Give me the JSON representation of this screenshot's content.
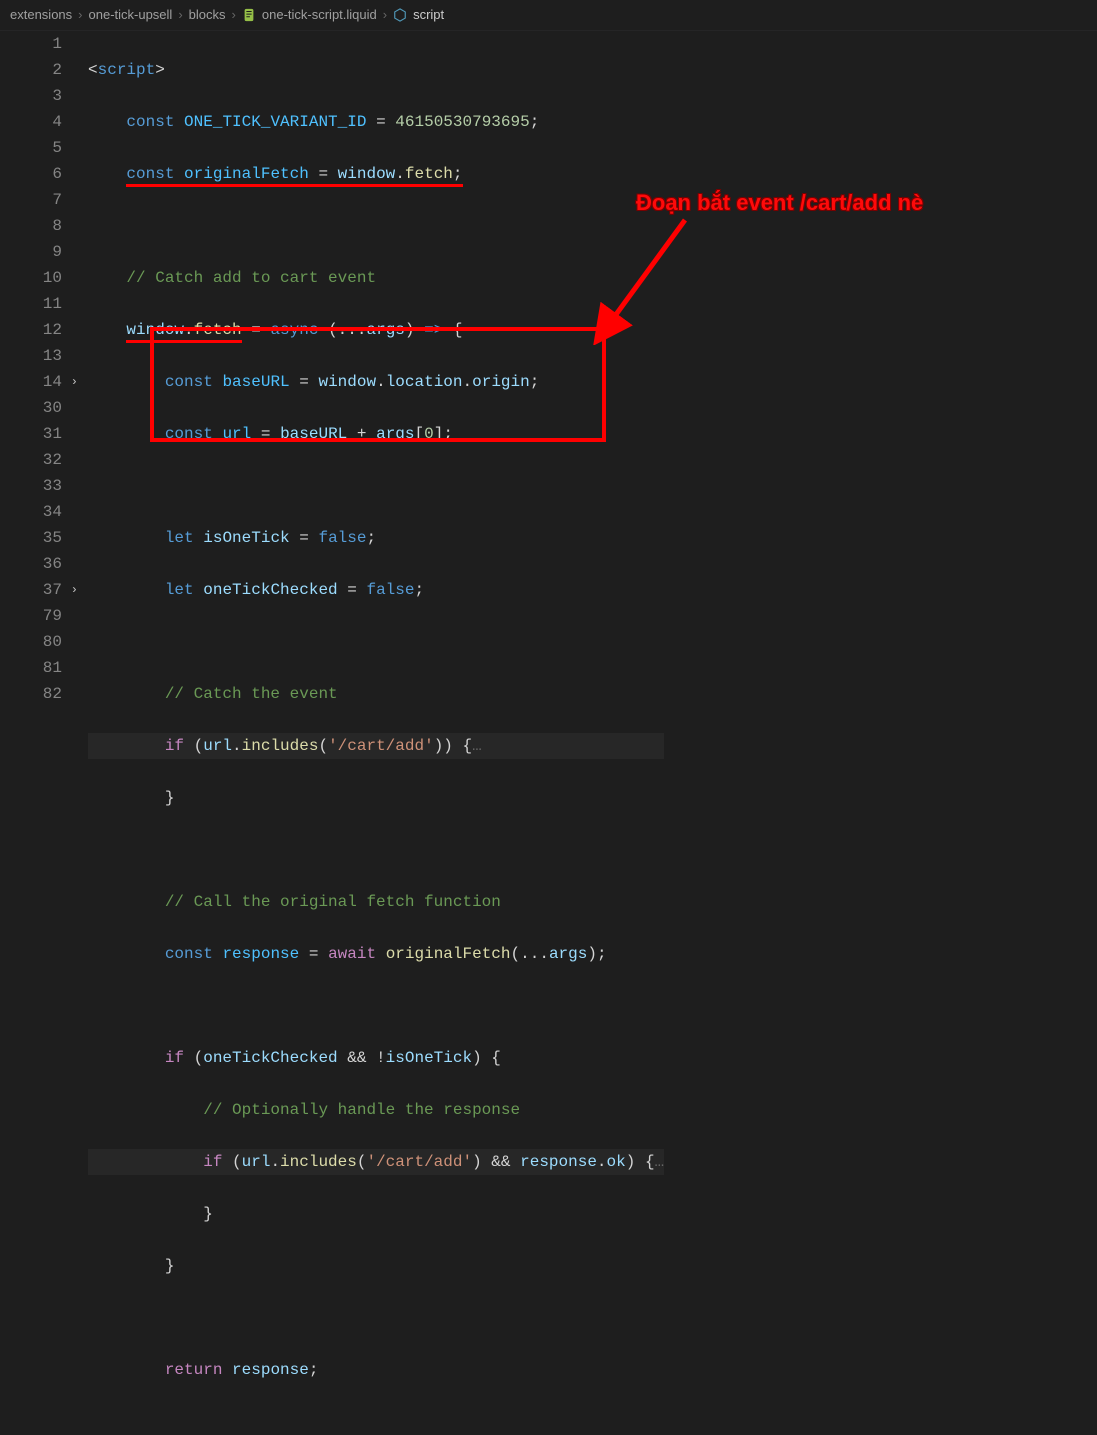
{
  "breadcrumb": {
    "seg1": "extensions",
    "seg2": "one-tick-upsell",
    "seg3": "blocks",
    "seg4": "one-tick-script.liquid",
    "seg5": "script"
  },
  "lines": {
    "n1": "1",
    "n2": "2",
    "n3": "3",
    "n4": "4",
    "n5": "5",
    "n6": "6",
    "n7": "7",
    "n8": "8",
    "n9": "9",
    "n10": "10",
    "n11": "11",
    "n12": "12",
    "n13": "13",
    "n14": "14",
    "n30": "30",
    "n31": "31",
    "n32": "32",
    "n33": "33",
    "n34": "34",
    "n35": "35",
    "n36": "36",
    "n37": "37",
    "n79": "79",
    "n80": "80",
    "n81": "81",
    "n82": "82"
  },
  "code": {
    "l1a": "<",
    "l1b": "script",
    "l1c": ">",
    "l2a": "const",
    "l2b": "ONE_TICK_VARIANT_ID",
    "l2c": " = ",
    "l2d": "46150530793695",
    "l2e": ";",
    "l3a": "const",
    "l3b": "originalFetch",
    "l3c": " = ",
    "l3d": "window",
    "l3e": ".",
    "l3f": "fetch",
    "l3g": ";",
    "l5a": "// Catch add to cart event",
    "l6a": "window",
    "l6b": ".",
    "l6c": "fetch",
    "l6d": " = ",
    "l6e": "async",
    "l6f": " (",
    "l6g": "...",
    "l6h": "args",
    "l6i": ") ",
    "l6j": "=>",
    "l6k": " {",
    "l7a": "const",
    "l7b": "baseURL",
    "l7c": " = ",
    "l7d": "window",
    "l7e": ".",
    "l7f": "location",
    "l7g": ".",
    "l7h": "origin",
    "l7i": ";",
    "l8a": "const",
    "l8b": "url",
    "l8c": " = ",
    "l8d": "baseURL",
    "l8e": " + ",
    "l8f": "args",
    "l8g": "[",
    "l8h": "0",
    "l8i": "];",
    "l10a": "let",
    "l10b": "isOneTick",
    "l10c": " = ",
    "l10d": "false",
    "l10e": ";",
    "l11a": "let",
    "l11b": "oneTickChecked",
    "l11c": " = ",
    "l11d": "false",
    "l11e": ";",
    "l13a": "// Catch the event",
    "l14a": "if",
    "l14b": " (",
    "l14c": "url",
    "l14d": ".",
    "l14e": "includes",
    "l14f": "(",
    "l14g": "'/cart/add'",
    "l14h": ")) {",
    "l14i": "…",
    "l30a": "}",
    "l32a": "// Call the original fetch function",
    "l33a": "const",
    "l33b": "response",
    "l33c": " = ",
    "l33d": "await",
    "l33e": " ",
    "l33f": "originalFetch",
    "l33g": "(",
    "l33h": "...",
    "l33i": "args",
    "l33j": ");",
    "l35a": "if",
    "l35b": " (",
    "l35c": "oneTickChecked",
    "l35d": " && !",
    "l35e": "isOneTick",
    "l35f": ") {",
    "l36a": "// Optionally handle the response",
    "l37a": "if",
    "l37b": " (",
    "l37c": "url",
    "l37d": ".",
    "l37e": "includes",
    "l37f": "(",
    "l37g": "'/cart/add'",
    "l37h": ") && ",
    "l37i": "response",
    "l37j": ".",
    "l37k": "ok",
    "l37l": ") {",
    "l37m": "…",
    "l79a": "}",
    "l80a": "}",
    "l82a": "return",
    "l82b": " ",
    "l82c": "response",
    "l82d": ";"
  },
  "annotation_text": "Đoạn bắt event /cart/add nè",
  "fold_icons": {
    "l14": "›",
    "l37": "›"
  }
}
